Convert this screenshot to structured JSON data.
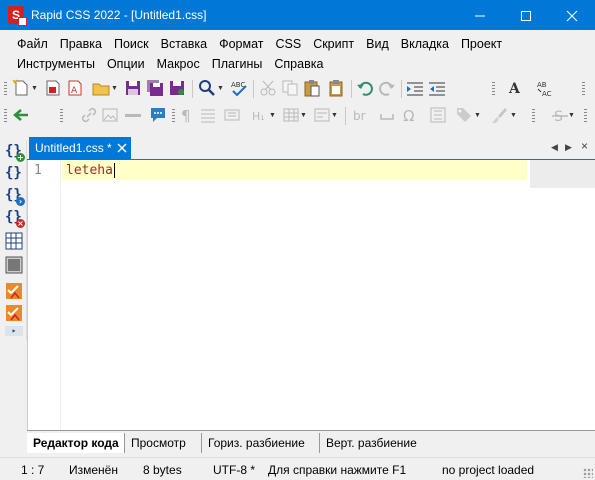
{
  "window": {
    "title": "Rapid CSS 2022 - [Untitled1.css]",
    "app_icon_letter": "S",
    "accent": "#0078d7"
  },
  "menu": {
    "row1": [
      "Файл",
      "Правка",
      "Поиск",
      "Вставка",
      "Формат",
      "CSS",
      "Скрипт",
      "Вид",
      "Вкладка",
      "Проект"
    ],
    "row2": [
      "Инструменты",
      "Опции",
      "Макрос",
      "Плагины",
      "Справка"
    ]
  },
  "tabs": {
    "document": "Untitled1.css *"
  },
  "editor": {
    "line_number": "1",
    "line_text": "leteha",
    "text_color": "#a52a2a",
    "current_line_color": "#ffffc8"
  },
  "view_tabs": [
    "Редактор кода",
    "Просмотр",
    "Гориз. разбиение",
    "Верт. разбиение"
  ],
  "status": {
    "position": "1 : 7",
    "modified": "Изменён",
    "size": "8 bytes",
    "encoding": "UTF-8 *",
    "help": "Для справки нажмите F1",
    "project": "no project loaded"
  }
}
